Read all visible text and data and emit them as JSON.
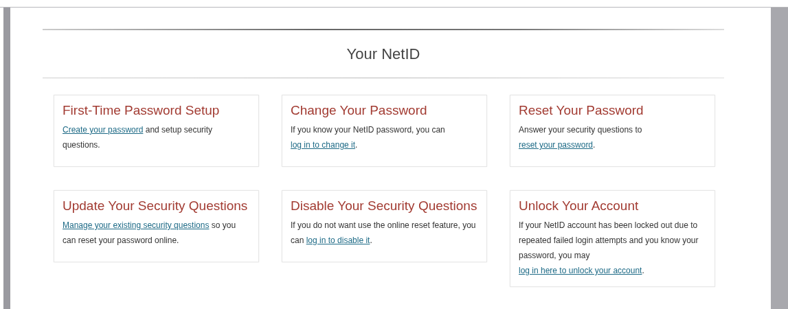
{
  "page": {
    "title": "Your NetID"
  },
  "cards": [
    {
      "title": "First-Time Password Setup",
      "link": "Create your password",
      "after": " and setup security questions."
    },
    {
      "title": "Change Your Password",
      "before": "If you know your NetID password, you can ",
      "link": "log in to change it",
      "after": "."
    },
    {
      "title": "Reset Your Password",
      "before": "Answer your security questions to ",
      "link": "reset your password",
      "after": "."
    },
    {
      "title": "Update Your Security Questions",
      "link": "Manage your existing security questions",
      "after": " so you can reset your password online."
    },
    {
      "title": "Disable Your Security Questions",
      "before": "If you do not want use the online reset feature, you can ",
      "link": "log in to disable it",
      "after": "."
    },
    {
      "title": "Unlock Your Account",
      "before": "If your NetID account has been locked out due to repeated failed login attempts and you know your password, you may ",
      "link": "log in here to unlock your account",
      "after": "."
    }
  ]
}
